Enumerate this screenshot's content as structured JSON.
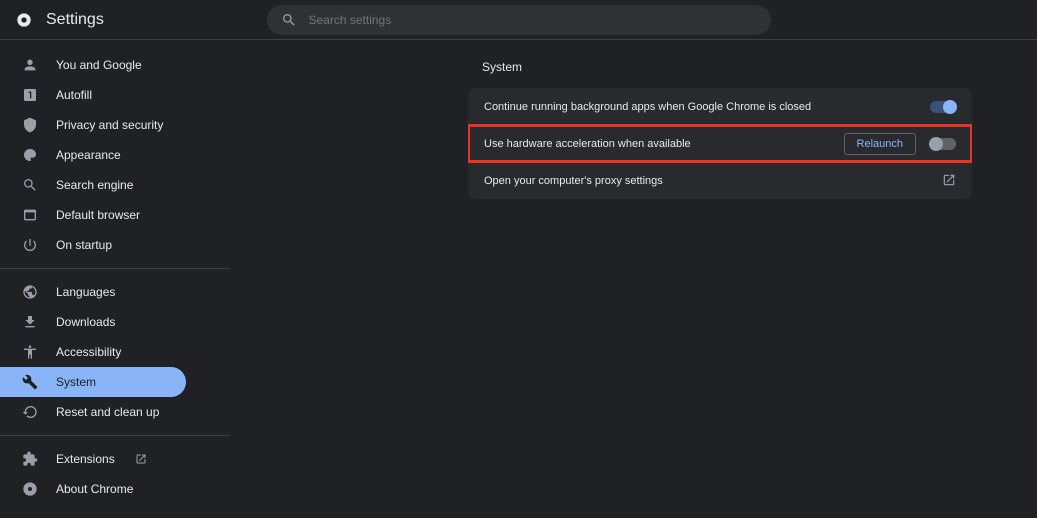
{
  "header": {
    "title": "Settings",
    "search_placeholder": "Search settings"
  },
  "sidebar": {
    "group1": [
      {
        "icon": "person-icon",
        "label": "You and Google"
      },
      {
        "icon": "autofill-icon",
        "label": "Autofill"
      },
      {
        "icon": "shield-icon",
        "label": "Privacy and security"
      },
      {
        "icon": "appearance-icon",
        "label": "Appearance"
      },
      {
        "icon": "search-engine-icon",
        "label": "Search engine"
      },
      {
        "icon": "browser-icon",
        "label": "Default browser"
      },
      {
        "icon": "power-icon",
        "label": "On startup"
      }
    ],
    "group2": [
      {
        "icon": "globe-icon",
        "label": "Languages"
      },
      {
        "icon": "download-icon",
        "label": "Downloads"
      },
      {
        "icon": "accessibility-icon",
        "label": "Accessibility"
      },
      {
        "icon": "wrench-icon",
        "label": "System"
      },
      {
        "icon": "history-icon",
        "label": "Reset and clean up"
      }
    ],
    "group3": [
      {
        "icon": "extension-icon",
        "label": "Extensions",
        "external": true
      },
      {
        "icon": "chrome-icon",
        "label": "About Chrome"
      }
    ]
  },
  "main": {
    "heading": "System",
    "rows": [
      {
        "label": "Continue running background apps when Google Chrome is closed",
        "toggle": "on",
        "highlight": false
      },
      {
        "label": "Use hardware acceleration when available",
        "toggle": "off",
        "highlight": true,
        "relaunch_label": "Relaunch"
      },
      {
        "label": "Open your computer's proxy settings",
        "link": true
      }
    ]
  }
}
